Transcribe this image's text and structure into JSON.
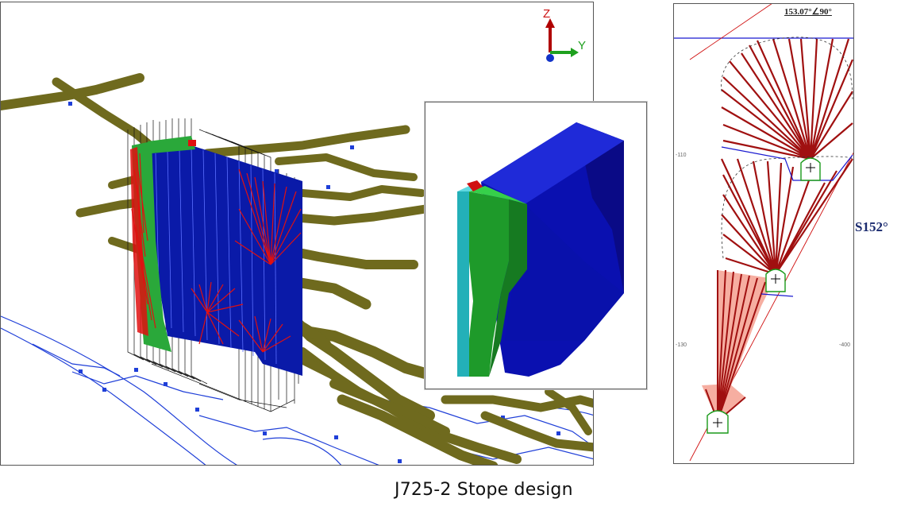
{
  "caption": "J725-2 Stope design",
  "axes": {
    "z": "Z",
    "y": "Y"
  },
  "section": {
    "bearing": "153.07°∠90°",
    "dip_label": "S152°",
    "elev_left_1": "-110",
    "elev_left_2": "-130",
    "elev_right_1": "-400"
  },
  "colors": {
    "drift": "#6f6a1e",
    "stope": "#0a1aa8",
    "green": "#2aa83a",
    "red": "#e01010",
    "cyan": "#2bb8c0",
    "survey_line": "#1f3fd8"
  }
}
